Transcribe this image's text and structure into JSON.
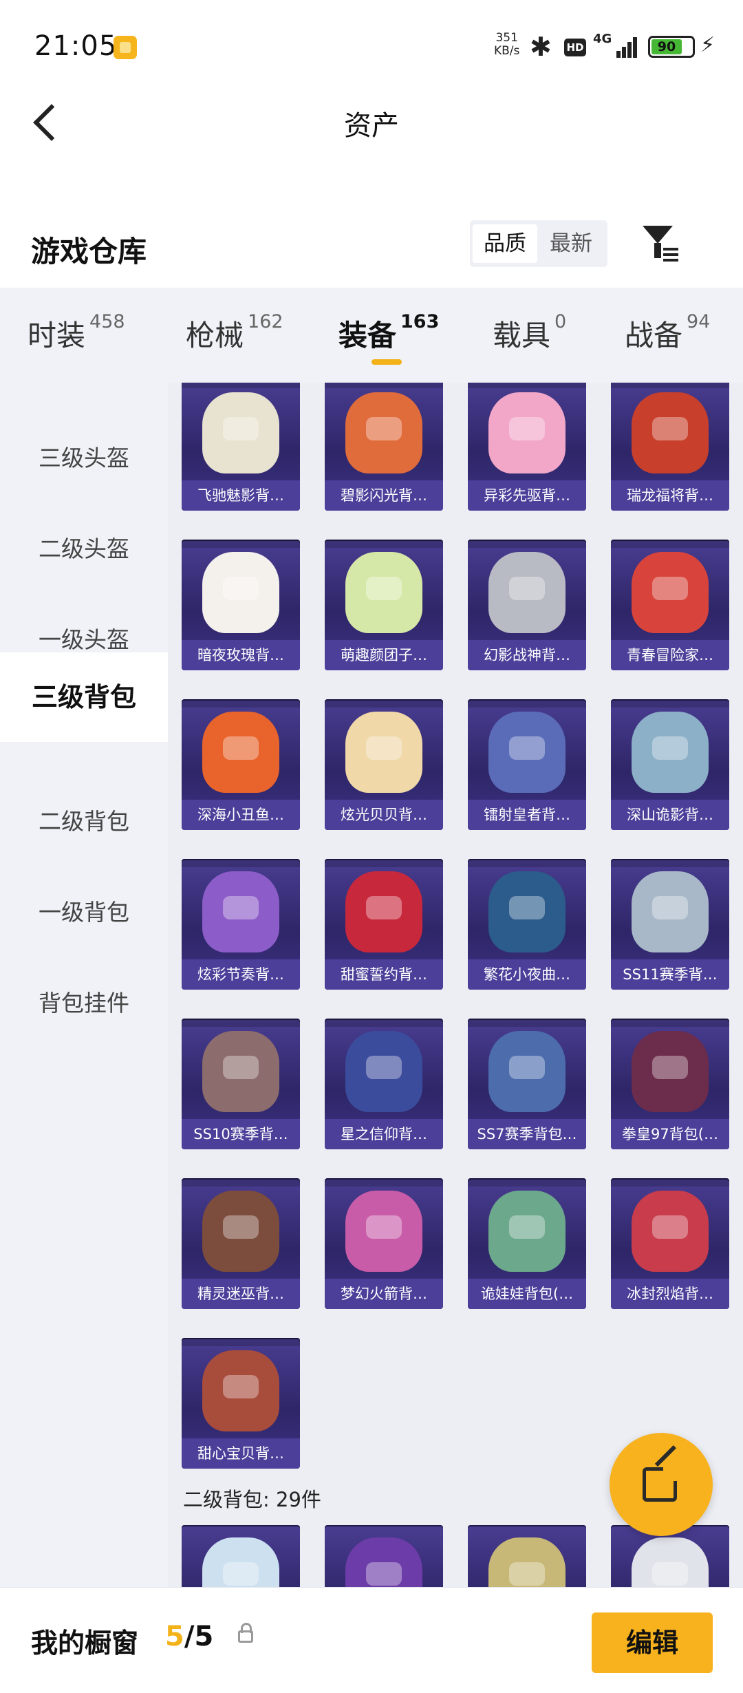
{
  "status": {
    "time": "21:05",
    "speed_value": "351",
    "speed_unit": "KB/s",
    "hd": "HD",
    "network": "4G",
    "battery": "90"
  },
  "header": {
    "title": "资产"
  },
  "section": {
    "title": "游戏仓库",
    "sort_options": [
      "品质",
      "最新"
    ],
    "sort_selected": "品质"
  },
  "tabs": [
    {
      "label": "时装",
      "count": "458"
    },
    {
      "label": "枪械",
      "count": "162"
    },
    {
      "label": "装备",
      "count": "163"
    },
    {
      "label": "载具",
      "count": "0"
    },
    {
      "label": "战备",
      "count": "94"
    }
  ],
  "active_tab": "装备",
  "sidebar": {
    "items": [
      "三级头盔",
      "二级头盔",
      "一级头盔",
      "三级背包",
      "二级背包",
      "一级背包",
      "背包挂件"
    ],
    "active": "三级背包"
  },
  "items": [
    {
      "name": "飞驰魅影背…",
      "color": "#e8e2d0"
    },
    {
      "name": "碧影闪光背…",
      "color": "#e06c3c"
    },
    {
      "name": "异彩先驱背…",
      "color": "#f2a7c8"
    },
    {
      "name": "瑞龙福将背…",
      "color": "#c8402c"
    },
    {
      "name": "暗夜玫瑰背…",
      "color": "#f4f0ec"
    },
    {
      "name": "萌趣颜团子…",
      "color": "#d6e8a8"
    },
    {
      "name": "幻影战神背…",
      "color": "#b8bac4"
    },
    {
      "name": "青春冒险家…",
      "color": "#d8443c"
    },
    {
      "name": "深海小丑鱼…",
      "color": "#e8642c"
    },
    {
      "name": "炫光贝贝背…",
      "color": "#f0d8a8"
    },
    {
      "name": "镭射皇者背…",
      "color": "#5a6cb8"
    },
    {
      "name": "深山诡影背…",
      "color": "#8cb0c8"
    },
    {
      "name": "炫彩节奏背…",
      "color": "#8c5cc8"
    },
    {
      "name": "甜蜜誓约背…",
      "color": "#c8283c"
    },
    {
      "name": "繁花小夜曲…",
      "color": "#2c5c8c"
    },
    {
      "name": "SS11赛季背…",
      "color": "#a8b8c8"
    },
    {
      "name": "SS10赛季背…",
      "color": "#8c6c6c"
    },
    {
      "name": "星之信仰背…",
      "color": "#3c4c9c"
    },
    {
      "name": "SS7赛季背包…",
      "color": "#4c6cac"
    },
    {
      "name": "拳皇97背包(…",
      "color": "#6c2c4c"
    },
    {
      "name": "精灵迷巫背…",
      "color": "#7c4c3c"
    },
    {
      "name": "梦幻火箭背…",
      "color": "#c85ca8"
    },
    {
      "name": "诡娃娃背包(…",
      "color": "#6ca88c"
    },
    {
      "name": "冰封烈焰背…",
      "color": "#c83c4c"
    },
    {
      "name": "甜心宝贝背…",
      "color": "#a84c3c"
    }
  ],
  "level2": {
    "heading": "二级背包: 29件",
    "previews": [
      {
        "color": "#cce0f0"
      },
      {
        "color": "#6c3ca8"
      },
      {
        "color": "#c8b878"
      },
      {
        "color": "#e0e4ea"
      }
    ]
  },
  "bottom": {
    "label": "我的橱窗",
    "current": "5",
    "separator": "/",
    "total": "5",
    "edit_label": "编辑"
  },
  "colors": {
    "accent": "#f7b21e",
    "card_bg": "#3b3280",
    "panel_bg": "#f0f2f7"
  }
}
